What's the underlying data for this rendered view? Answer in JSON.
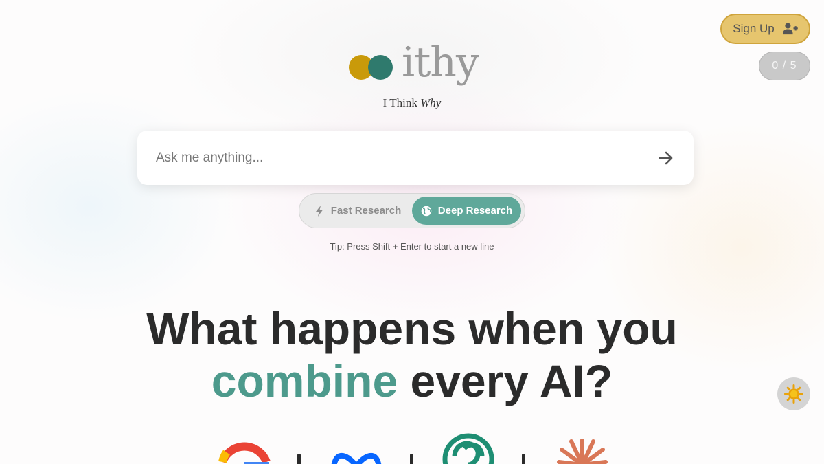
{
  "header": {
    "signup_label": "Sign Up",
    "usage_counter": "0 / 5"
  },
  "brand": {
    "wordmark": "ithy",
    "tagline_prefix": "I Think ",
    "tagline_emphasis": "Why",
    "colors": {
      "gold": "#c99a0a",
      "teal": "#2f7a6d"
    }
  },
  "search": {
    "placeholder": "Ask me anything...",
    "value": ""
  },
  "modes": {
    "fast_label": "Fast Research",
    "deep_label": "Deep Research",
    "selected": "Deep Research"
  },
  "tip": "Tip: Press Shift + Enter to start a new line",
  "hero": {
    "line1": "What happens when you",
    "accent_word": "combine",
    "line2_rest": " every AI?"
  },
  "ai_logos": [
    "google-icon",
    "meta-icon",
    "openai-icon",
    "anthropic-icon"
  ],
  "theme": {
    "mode": "light",
    "icon": "sun-icon"
  }
}
